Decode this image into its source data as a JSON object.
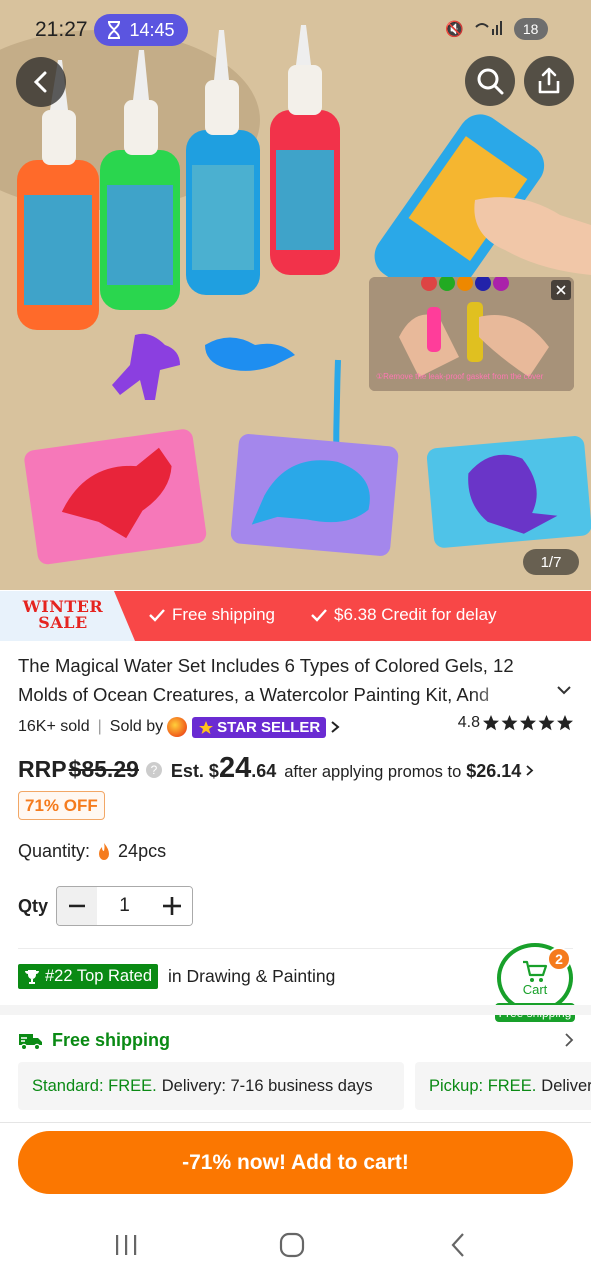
{
  "status_bar": {
    "time": "21:27",
    "timer": "14:45",
    "battery": "18"
  },
  "gallery": {
    "counter": "1/7",
    "video_caption": "①Remove the leak-proof gasket from the cover"
  },
  "promo_banner": {
    "sale_line1": "WINTER",
    "sale_line2": "SALE",
    "free_shipping": "Free shipping",
    "credit": "$6.38 Credit for delay"
  },
  "product": {
    "title": "The Magical Water Set Includes 6 Types of Colored Gels, 12 Molds of Ocean Creatures, a Watercolor Painting Kit, And",
    "sold": "16K+ sold",
    "sold_by": "Sold by",
    "seller_badge": "STAR  SELLER",
    "rating": "4.8",
    "rrp_label": "RRP",
    "rrp_price": "$85.29",
    "est_label": "Est. $",
    "est_whole": "24",
    "est_cents": ".64",
    "after_text": "after applying promos to",
    "after_price": "$26.14",
    "discount": "71% OFF",
    "quantity_label": "Quantity:",
    "quantity_value": "24pcs",
    "qty_label": "Qty",
    "qty_value": "1",
    "top_rated": "#22 Top Rated",
    "top_rated_category": "in Drawing & Painting"
  },
  "cart": {
    "label": "Cart",
    "count": "2",
    "free_shipping": "Free shipping"
  },
  "shipping": {
    "title": "Free shipping",
    "standard_label": "Standard: FREE.",
    "standard_detail": "Delivery: 7-16 business days",
    "pickup_label": "Pickup: FREE.",
    "pickup_detail": "Delivery"
  },
  "cta": {
    "label": "-71% now! Add to cart!"
  },
  "colors": {
    "accent_orange": "#fb7701",
    "promo_red": "#f84747",
    "green": "#0a8a14",
    "seller_purple": "#6a2bd2"
  },
  "icons": [
    "back-arrow-icon",
    "search-icon",
    "share-icon",
    "close-icon",
    "check-icon",
    "chevron-down-icon",
    "chevron-right-icon",
    "help-icon",
    "flame-icon",
    "star-icon",
    "trophy-icon",
    "cart-icon",
    "truck-icon",
    "recents-icon",
    "home-icon",
    "nav-back-icon"
  ]
}
